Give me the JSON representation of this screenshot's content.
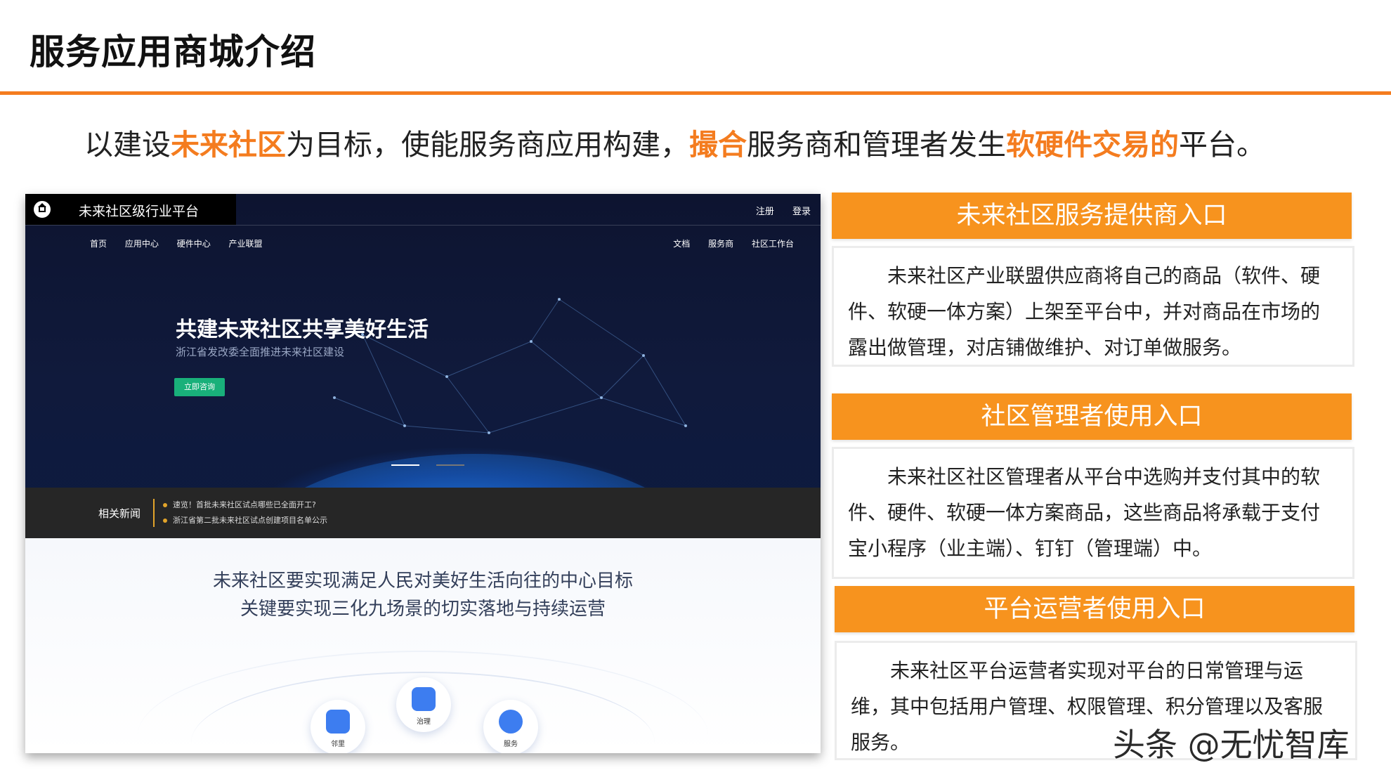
{
  "slide": {
    "title": "服务应用商城介绍",
    "tagline": {
      "p1": "以建设",
      "h1": "未来社区",
      "p2": "为目标，使能服务商应用构建，",
      "h2": "撮合",
      "p3": "服务商和管理者发生",
      "h3": "软硬件交易的",
      "p4": "平台。"
    },
    "colors": {
      "accent": "#f47c1f",
      "panel_header": "#f7931e",
      "hero_bg": "#0d1430",
      "cta_green": "#19b07a"
    }
  },
  "screenshot": {
    "site_name": "未来社区级行业平台",
    "auth": {
      "register": "注册",
      "login": "登录"
    },
    "nav_left": [
      "首页",
      "应用中心",
      "硬件中心",
      "产业联盟"
    ],
    "nav_right": [
      "文档",
      "服务商",
      "社区工作台"
    ],
    "hero": {
      "title": "共建未来社区共享美好生活",
      "subtitle": "浙江省发改委全面推进未来社区建设",
      "cta": "立即咨询"
    },
    "news": {
      "label": "相关新闻",
      "items": [
        "速览！首批未来社区试点哪些已全面开工?",
        "浙江省第二批未来社区试点创建项目名单公示"
      ]
    },
    "lower": {
      "line1": "未来社区要实现满足人民对美好生活向往的中心目标",
      "line2": "关键要实现三化九场景的切实落地与持续运营",
      "circles": [
        {
          "label": "邻里",
          "icon": "people-icon"
        },
        {
          "label": "治理",
          "icon": "document-icon"
        },
        {
          "label": "服务",
          "icon": "heart-icon"
        }
      ]
    }
  },
  "panels": [
    {
      "title": "未来社区服务提供商入口",
      "body": "未来社区产业联盟供应商将自己的商品（软件、硬件、软硬一体方案）上架至平台中，并对商品在市场的露出做管理，对店铺做维护、对订单做服务。"
    },
    {
      "title": "社区管理者使用入口",
      "body": "未来社区社区管理者从平台中选购并支付其中的软件、硬件、软硬一体方案商品，这些商品将承载于支付宝小程序（业主端）、钉钉（管理端）中。"
    },
    {
      "title": "平台运营者使用入口",
      "body": "未来社区平台运营者实现对平台的日常管理与运维，其中包括用户管理、权限管理、积分管理以及客服服务。"
    }
  ],
  "watermark": "头条 @无忧智库"
}
